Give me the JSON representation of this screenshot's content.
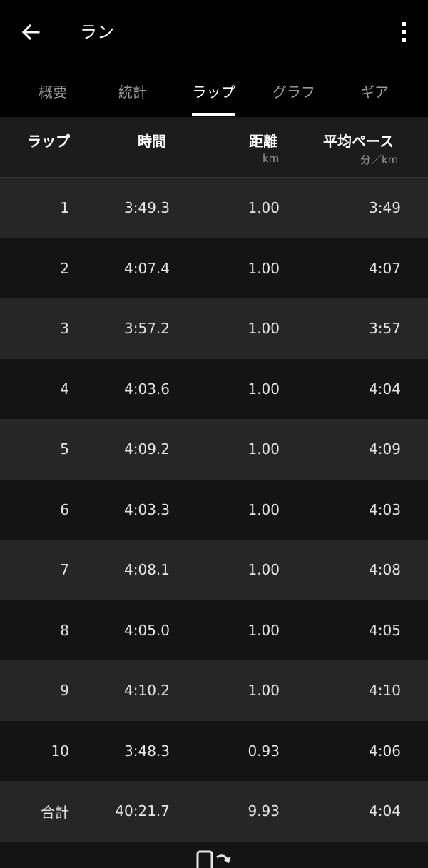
{
  "appbar": {
    "title": "ラン",
    "back_icon": "arrow-left-icon",
    "more_icon": "more-vertical-icon"
  },
  "tabs": [
    {
      "label": "概要",
      "active": false
    },
    {
      "label": "統計",
      "active": false
    },
    {
      "label": "ラップ",
      "active": true
    },
    {
      "label": "グラフ",
      "active": false
    },
    {
      "label": "ギア",
      "active": false
    }
  ],
  "table": {
    "headers": {
      "lap": "ラップ",
      "time": "時間",
      "distance": "距離",
      "distance_unit": "km",
      "pace": "平均ペース",
      "pace_unit": "分／km"
    },
    "rows": [
      {
        "lap": "1",
        "time": "3:49.3",
        "distance": "1.00",
        "pace": "3:49"
      },
      {
        "lap": "2",
        "time": "4:07.4",
        "distance": "1.00",
        "pace": "4:07"
      },
      {
        "lap": "3",
        "time": "3:57.2",
        "distance": "1.00",
        "pace": "3:57"
      },
      {
        "lap": "4",
        "time": "4:03.6",
        "distance": "1.00",
        "pace": "4:04"
      },
      {
        "lap": "5",
        "time": "4:09.2",
        "distance": "1.00",
        "pace": "4:09"
      },
      {
        "lap": "6",
        "time": "4:03.3",
        "distance": "1.00",
        "pace": "4:03"
      },
      {
        "lap": "7",
        "time": "4:08.1",
        "distance": "1.00",
        "pace": "4:08"
      },
      {
        "lap": "8",
        "time": "4:05.0",
        "distance": "1.00",
        "pace": "4:05"
      },
      {
        "lap": "9",
        "time": "4:10.2",
        "distance": "1.00",
        "pace": "4:10"
      },
      {
        "lap": "10",
        "time": "3:48.3",
        "distance": "0.93",
        "pace": "4:06"
      }
    ],
    "total": {
      "lap": "合計",
      "time": "40:21.7",
      "distance": "9.93",
      "pace": "4:04"
    }
  },
  "bottom": {
    "sync_icon": "phone-sync-icon"
  },
  "colors": {
    "background": "#000000",
    "header_row": "#1c1c1c",
    "row_light": "#262626",
    "row_dark": "#141414",
    "tab_inactive": "#9b9b9b",
    "text": "#ffffff"
  }
}
